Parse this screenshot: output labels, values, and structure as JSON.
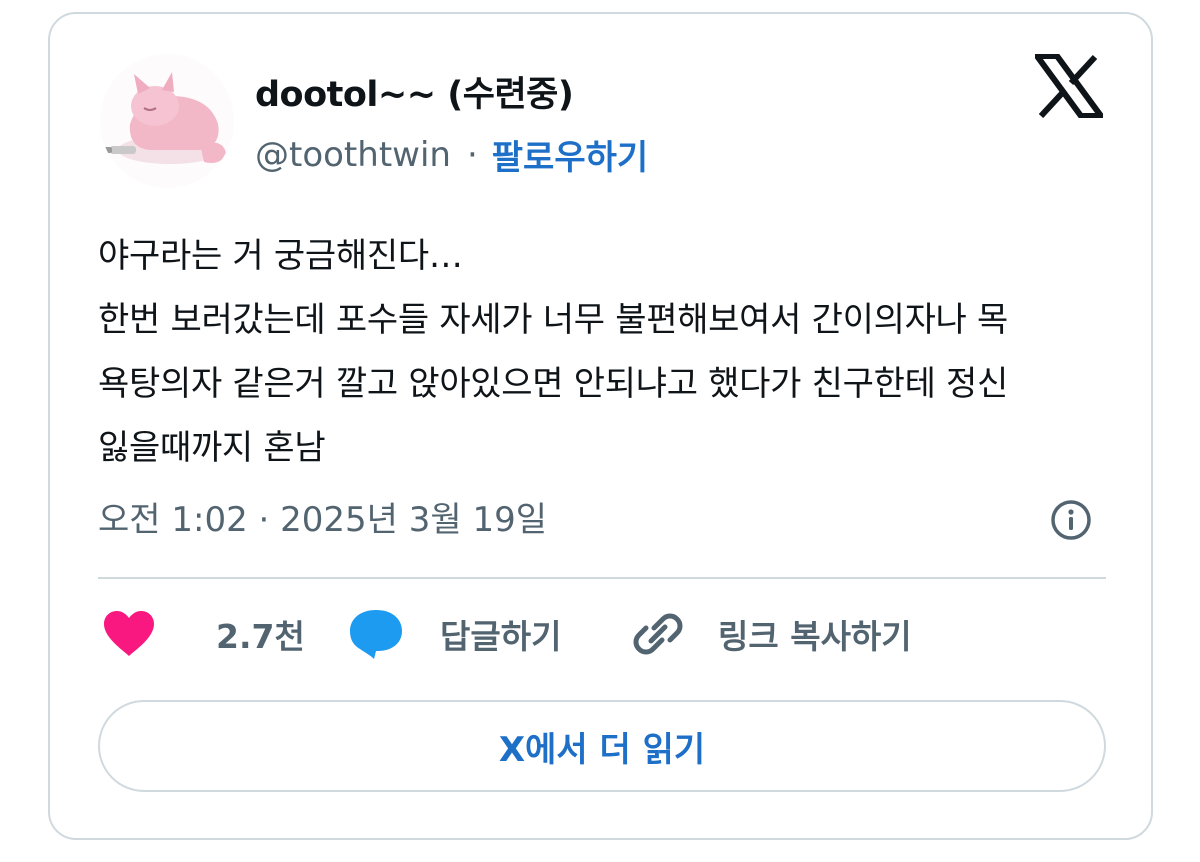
{
  "user": {
    "display_name": "dootol~~ (수련중)",
    "handle": "@toothtwin",
    "separator": "·",
    "follow_label": "팔로우하기"
  },
  "tweet": {
    "lines": [
      "야구라는 거 궁금해진다…",
      "한번 보러갔는데 포수들 자세가 너무 불편해보여서 간이의자나 목",
      "욕탕의자 같은거 깔고 앉아있으면 안되냐고 했다가 친구한테 정신",
      "잃을때까지 혼남"
    ],
    "timestamp": "오전 1:02 · 2025년 3월 19일"
  },
  "actions": {
    "like_count": "2.7천",
    "reply_label": "답글하기",
    "copy_link_label": "링크 복사하기"
  },
  "read_more_label": "X에서 더 읽기",
  "colors": {
    "accent": "#1d6fc8",
    "like": "#f91880",
    "reply_icon": "#1d9bf0",
    "muted": "#536471",
    "border": "#cfd9de"
  },
  "icons": {
    "logo": "x-logo-icon",
    "info": "info-icon",
    "like": "heart-icon",
    "reply": "speech-bubble-icon",
    "copy": "link-icon"
  }
}
